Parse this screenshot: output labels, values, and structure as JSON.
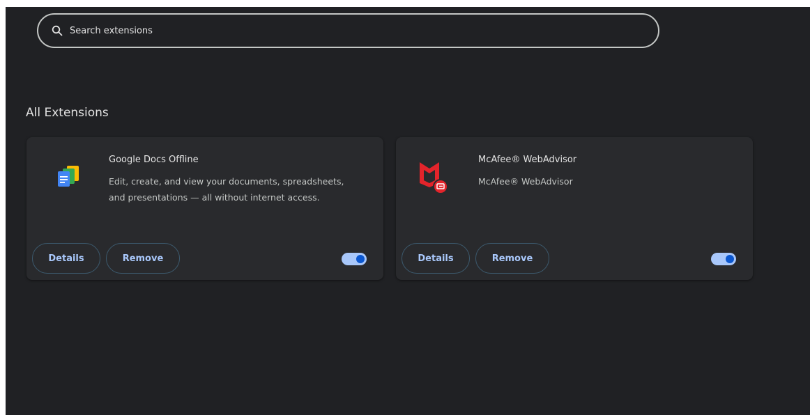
{
  "search": {
    "placeholder": "Search extensions"
  },
  "section": {
    "title": "All Extensions"
  },
  "extensions": [
    {
      "name": "Google Docs Offline",
      "description": "Edit, create, and view your documents, spreadsheets, and presentations — all without internet access.",
      "icon": "google-docs-offline-icon",
      "enabled": true,
      "details_label": "Details",
      "remove_label": "Remove"
    },
    {
      "name": "McAfee® WebAdvisor",
      "description": "McAfee® WebAdvisor",
      "icon": "mcafee-webadvisor-icon",
      "enabled": true,
      "details_label": "Details",
      "remove_label": "Remove"
    }
  ],
  "colors": {
    "background": "#202124",
    "card": "#292a2d",
    "accent": "#a8c7fa",
    "toggle_knob": "#0b57d0",
    "mcafee_red": "#e3242b"
  }
}
